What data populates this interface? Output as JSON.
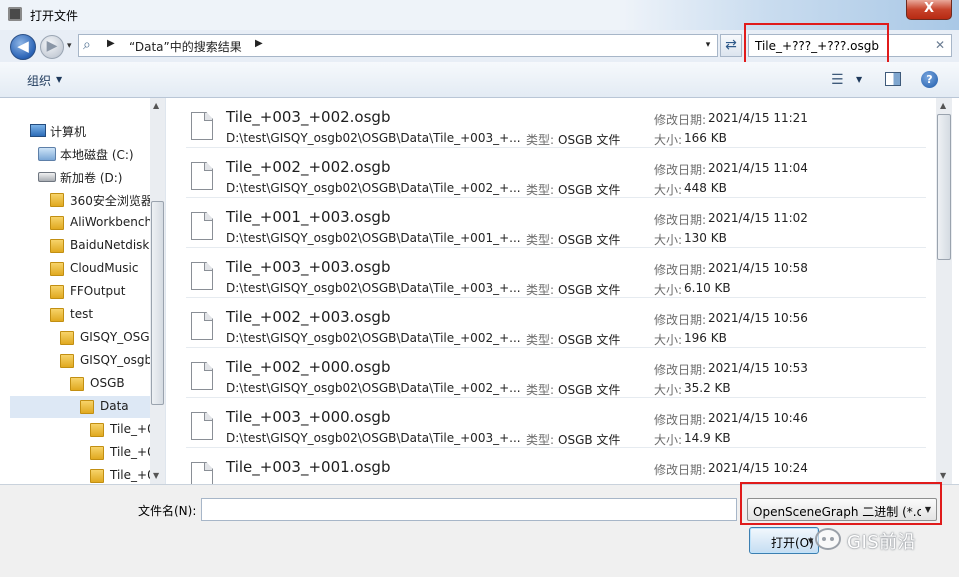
{
  "window": {
    "title": "打开文件",
    "close_glyph": "X"
  },
  "address": {
    "back_glyph": "◀",
    "forward_glyph": "▶",
    "breadcrumb": "“Data”中的搜索结果",
    "sep_glyph": "▶",
    "dropdown_glyph": "▾"
  },
  "search": {
    "value": "Tile_+???_+???.osgb",
    "clear_glyph": "✕"
  },
  "toolbar": {
    "organize_label": "组织",
    "dropdown_glyph": "▼",
    "help_glyph": "?"
  },
  "tree": {
    "items": [
      {
        "label": "计算机",
        "icon": "computer-icon"
      },
      {
        "label": "本地磁盘 (C:)",
        "icon": "drive-c-icon"
      },
      {
        "label": "新加卷 (D:)",
        "icon": "drive-icon"
      },
      {
        "label": "360安全浏览器",
        "icon": "folder-icon"
      },
      {
        "label": "AliWorkbench",
        "icon": "folder-icon"
      },
      {
        "label": "BaiduNetdisk",
        "icon": "folder-icon"
      },
      {
        "label": "CloudMusic",
        "icon": "folder-icon"
      },
      {
        "label": "FFOutput",
        "icon": "folder-icon"
      },
      {
        "label": "test",
        "icon": "folder-icon"
      },
      {
        "label": "GISQY_OSG",
        "icon": "folder-icon"
      },
      {
        "label": "GISQY_osgb",
        "icon": "folder-icon"
      },
      {
        "label": "OSGB",
        "icon": "folder-icon"
      },
      {
        "label": "Data",
        "icon": "folder-icon"
      },
      {
        "label": "Tile_+0",
        "icon": "folder-icon"
      },
      {
        "label": "Tile_+0",
        "icon": "folder-icon"
      },
      {
        "label": "Tile_+0",
        "icon": "folder-icon"
      }
    ]
  },
  "files": {
    "type_label": "类型:",
    "date_label": "修改日期:",
    "size_label": "大小:",
    "rows": [
      {
        "name": "Tile_+003_+002.osgb",
        "path": "D:\\test\\GISQY_osgb02\\OSGB\\Data\\Tile_+003_+...",
        "type": "OSGB 文件",
        "date": "2021/4/15 11:21",
        "size": "166 KB"
      },
      {
        "name": "Tile_+002_+002.osgb",
        "path": "D:\\test\\GISQY_osgb02\\OSGB\\Data\\Tile_+002_+...",
        "type": "OSGB 文件",
        "date": "2021/4/15 11:04",
        "size": "448 KB"
      },
      {
        "name": "Tile_+001_+003.osgb",
        "path": "D:\\test\\GISQY_osgb02\\OSGB\\Data\\Tile_+001_+...",
        "type": "OSGB 文件",
        "date": "2021/4/15 11:02",
        "size": "130 KB"
      },
      {
        "name": "Tile_+003_+003.osgb",
        "path": "D:\\test\\GISQY_osgb02\\OSGB\\Data\\Tile_+003_+...",
        "type": "OSGB 文件",
        "date": "2021/4/15 10:58",
        "size": "6.10 KB"
      },
      {
        "name": "Tile_+002_+003.osgb",
        "path": "D:\\test\\GISQY_osgb02\\OSGB\\Data\\Tile_+002_+...",
        "type": "OSGB 文件",
        "date": "2021/4/15 10:56",
        "size": "196 KB"
      },
      {
        "name": "Tile_+002_+000.osgb",
        "path": "D:\\test\\GISQY_osgb02\\OSGB\\Data\\Tile_+002_+...",
        "type": "OSGB 文件",
        "date": "2021/4/15 10:53",
        "size": "35.2 KB"
      },
      {
        "name": "Tile_+003_+000.osgb",
        "path": "D:\\test\\GISQY_osgb02\\OSGB\\Data\\Tile_+003_+...",
        "type": "OSGB 文件",
        "date": "2021/4/15 10:46",
        "size": "14.9 KB"
      },
      {
        "name": "Tile_+003_+001.osgb",
        "path": "",
        "type": "",
        "date": "2021/4/15 10:24",
        "size": ""
      }
    ]
  },
  "bottom": {
    "filename_label": "文件名(N):",
    "filename_value": "",
    "filter_value": "OpenSceneGraph 二进制 (*.c",
    "open_label": "打开(O)",
    "dropdown_glyph": "▼"
  },
  "watermark": {
    "text": "GIS前沿"
  },
  "colors": {
    "highlight": "#e01b1b",
    "selected": "#dde8f5"
  }
}
